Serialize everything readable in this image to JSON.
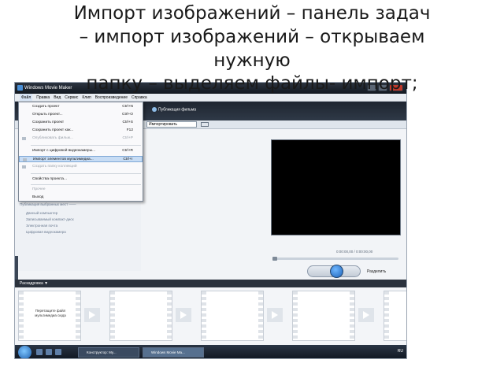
{
  "slide": {
    "title_line1": "Импорт изображений – панель задач",
    "title_line2": "– импорт изображений – открываем",
    "title_line3": "нужную",
    "title_line4": "папку – выделяем файлы- импорт;"
  },
  "window": {
    "title": "Windows Movie Maker"
  },
  "menubar": {
    "items": [
      "Файл",
      "Правка",
      "Вид",
      "Сервис",
      "Клип",
      "Воспроизведение",
      "Справка"
    ]
  },
  "toolbar": {
    "publish_label": "Публикация фильма",
    "import_dropdown": "Импортировать"
  },
  "file_menu": {
    "items": [
      {
        "label": "Создать проект",
        "shortcut": "Ctrl+N"
      },
      {
        "label": "Открыть проект...",
        "shortcut": "Ctrl+O"
      },
      {
        "label": "Сохранить проект",
        "shortcut": "Ctrl+S"
      },
      {
        "label": "Сохранить проект как...",
        "shortcut": "F12"
      },
      {
        "label": "Опубликовать фильм...",
        "shortcut": "Ctrl+P"
      },
      {
        "label": "Импорт с цифровой видеокамеры...",
        "shortcut": "Ctrl+R"
      },
      {
        "label": "Импорт элементов мультимедиа...",
        "shortcut": "Ctrl+I"
      },
      {
        "label": "Создать папку коллекций",
        "shortcut": ""
      },
      {
        "label": "Свойства проекта...",
        "shortcut": ""
      },
      {
        "label": "Прочее",
        "shortcut": ""
      },
      {
        "label": "Выход",
        "shortcut": ""
      }
    ]
  },
  "taskpane": {
    "publish_heading": "Публикация выбранных мест ——",
    "publish_items": [
      "Данный компьютер",
      "Записываемый компакт-диск",
      "Электронная почта",
      "Цифровая видеокамера"
    ]
  },
  "preview": {
    "time": "0:00:00,00 / 0:00:00,00",
    "split_label": "Разделить"
  },
  "storyboard": {
    "header": "Раскадровка ▼",
    "drop_hint": "Перетащите файл мультимедиа сюда"
  },
  "taskbar": {
    "tasks": [
      "Конструктор: My...",
      "Windows Movie Ma..."
    ],
    "tray": "RU"
  }
}
